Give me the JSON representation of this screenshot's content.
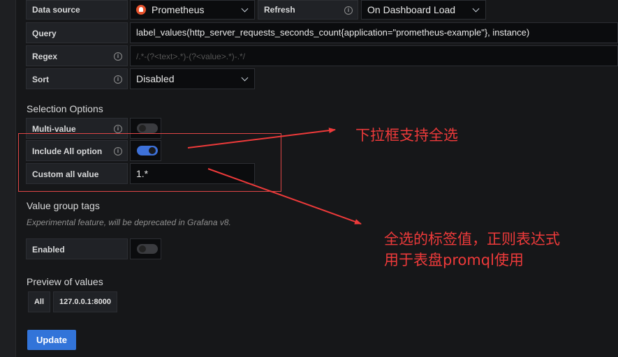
{
  "form": {
    "datasource": {
      "label": "Data source",
      "value": "Prometheus"
    },
    "refresh": {
      "label": "Refresh",
      "value": "On Dashboard Load"
    },
    "query": {
      "label": "Query",
      "value": "label_values(http_server_requests_seconds_count{application=\"prometheus-example\"}, instance)"
    },
    "regex": {
      "label": "Regex",
      "placeholder": "/.*-(?<text>.*)-(?<value>.*)-.*/"
    },
    "sort": {
      "label": "Sort",
      "value": "Disabled"
    }
  },
  "selection": {
    "title": "Selection Options",
    "multi_value": {
      "label": "Multi-value",
      "enabled": false
    },
    "include_all": {
      "label": "Include All option",
      "enabled": true
    },
    "custom_all": {
      "label": "Custom all value",
      "value": "1.*"
    }
  },
  "value_group": {
    "title": "Value group tags",
    "note": "Experimental feature, will be deprecated in Grafana v8.",
    "enabled": {
      "label": "Enabled",
      "enabled": false
    }
  },
  "preview": {
    "title": "Preview of values",
    "values": [
      "All",
      "127.0.0.1:8000"
    ]
  },
  "update_button": "Update",
  "annotations": {
    "first": "下拉框支持全选",
    "second_line1": "全选的标签值，正则表达式",
    "second_line2": "用于表盘promql使用",
    "color": "#ee3a3a"
  },
  "colors": {
    "accent": "#3274d9",
    "toggle_on": "#3d71d9",
    "annotation": "#ee3a3a"
  },
  "icons": {
    "datasource": "prometheus-logo-icon",
    "info": "info-icon",
    "caret": "chevron-down-icon"
  }
}
